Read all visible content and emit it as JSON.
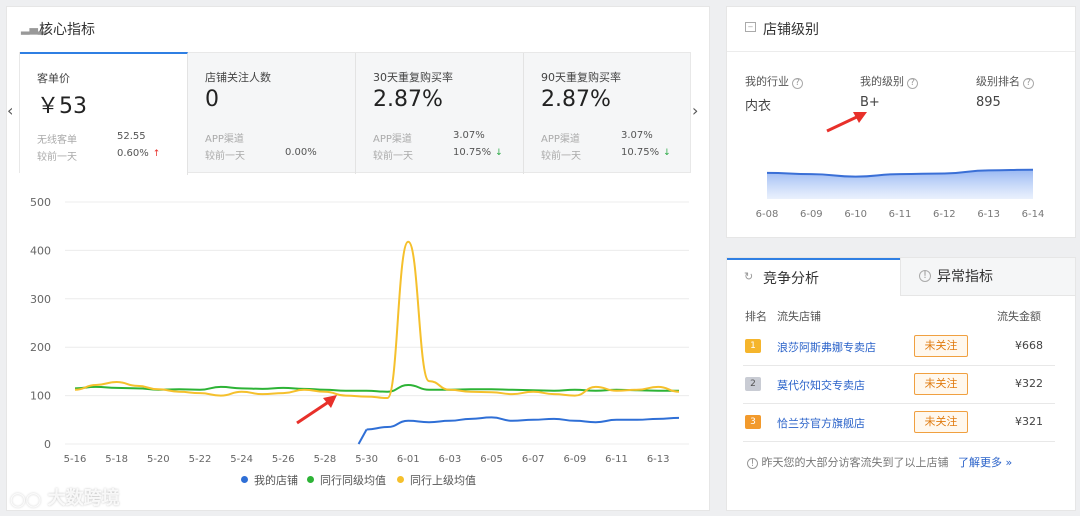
{
  "core": {
    "title": "核心指标",
    "metrics": [
      {
        "label": "客单价",
        "value": "￥53",
        "sub1_label": "无线客单",
        "sub1_value": "52.55",
        "sub2_label": "较前一天",
        "sub2_value": "0.60%",
        "trend": "up"
      },
      {
        "label": "店铺关注人数",
        "value": "0",
        "sub1_label": "APP渠道",
        "sub1_value": "",
        "sub2_label": "较前一天",
        "sub2_value": "0.00%",
        "trend": "none"
      },
      {
        "label": "30天重复购买率",
        "value": "2.87%",
        "sub1_label": "APP渠道",
        "sub1_value": "3.07%",
        "sub2_label": "较前一天",
        "sub2_value": "10.75%",
        "trend": "down"
      },
      {
        "label": "90天重复购买率",
        "value": "2.87%",
        "sub1_label": "APP渠道",
        "sub1_value": "3.07%",
        "sub2_label": "较前一天",
        "sub2_value": "10.75%",
        "trend": "down"
      }
    ],
    "legend": [
      "我的店铺",
      "同行同级均值",
      "同行上级均值"
    ]
  },
  "chart_data": [
    {
      "type": "line",
      "ylim": [
        0,
        500
      ],
      "yticks": [
        "500",
        "400",
        "300",
        "200",
        "100",
        "0"
      ],
      "xticks": [
        "5-16",
        "5-18",
        "5-20",
        "5-22",
        "5-24",
        "5-26",
        "5-28",
        "5-30",
        "6-01",
        "6-03",
        "6-05",
        "6-07",
        "6-09",
        "6-11",
        "6-13"
      ],
      "x": [
        "5-16",
        "5-17",
        "5-18",
        "5-19",
        "5-20",
        "5-21",
        "5-22",
        "5-23",
        "5-24",
        "5-25",
        "5-26",
        "5-27",
        "5-28",
        "5-29",
        "5-30",
        "5-31",
        "6-01",
        "6-02",
        "6-03",
        "6-04",
        "6-05",
        "6-06",
        "6-07",
        "6-08",
        "6-09",
        "6-10",
        "6-11",
        "6-12",
        "6-13",
        "6-14"
      ],
      "series": [
        {
          "name": "我的店铺",
          "color": "#2f6fd6",
          "values": [
            null,
            null,
            null,
            null,
            null,
            null,
            null,
            null,
            null,
            null,
            null,
            null,
            null,
            null,
            30,
            35,
            48,
            45,
            48,
            52,
            55,
            48,
            50,
            52,
            48,
            45,
            50,
            50,
            52,
            54
          ]
        },
        {
          "name": "同行同级均值",
          "color": "#2db336",
          "values": [
            115,
            118,
            116,
            115,
            112,
            113,
            112,
            118,
            115,
            114,
            116,
            114,
            112,
            110,
            110,
            108,
            122,
            112,
            112,
            113,
            113,
            112,
            111,
            110,
            112,
            110,
            112,
            111,
            110,
            110
          ]
        },
        {
          "name": "同行上级均值",
          "color": "#f5c02c",
          "values": [
            112,
            122,
            128,
            120,
            113,
            108,
            105,
            100,
            108,
            103,
            105,
            112,
            108,
            100,
            98,
            95,
            418,
            130,
            112,
            108,
            107,
            103,
            108,
            103,
            100,
            118,
            110,
            112,
            118,
            108
          ]
        }
      ]
    },
    {
      "type": "area",
      "x": [
        "6-08",
        "6-09",
        "6-10",
        "6-11",
        "6-12",
        "6-13",
        "6-14"
      ],
      "values": [
        74,
        72,
        68,
        72,
        73,
        78,
        79
      ],
      "color": "#3a6fd6"
    }
  ],
  "grade": {
    "title": "店铺级别",
    "industry_label": "我的行业",
    "industry_value": "内衣",
    "level_label": "我的级别",
    "level_value": "B+",
    "rank_label": "级别排名",
    "rank_value": "895"
  },
  "competition": {
    "tab_active": "竞争分析",
    "tab_inactive": "异常指标",
    "col_rank": "排名",
    "col_shop": "流失店铺",
    "col_amount": "流失金额",
    "rows": [
      {
        "rank": "1",
        "shop": "浪莎阿斯弗娜专卖店",
        "action": "未关注",
        "amount": "¥668"
      },
      {
        "rank": "2",
        "shop": "莫代尔知交专卖店",
        "action": "未关注",
        "amount": "¥322"
      },
      {
        "rank": "3",
        "shop": "恰兰芬官方旗舰店",
        "action": "未关注",
        "amount": "¥321"
      }
    ],
    "footer_text": "昨天您的大部分访客流失到了以上店铺",
    "footer_link": "了解更多 »"
  },
  "watermark": "大数跨境"
}
